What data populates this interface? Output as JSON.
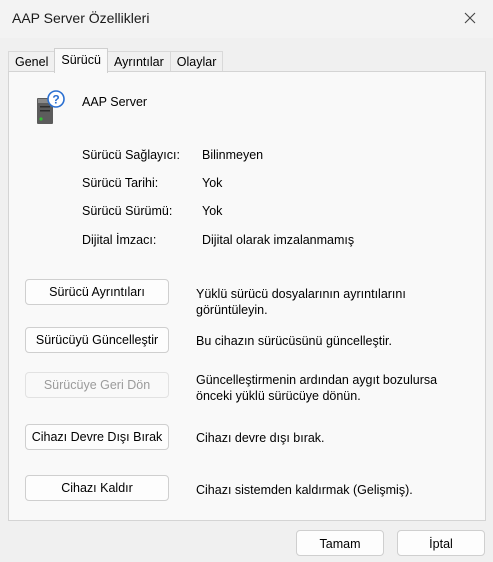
{
  "window": {
    "title": "AAP Server Özellikleri",
    "close_icon": "close-icon"
  },
  "tabs": [
    {
      "label": "Genel"
    },
    {
      "label": "Sürücü"
    },
    {
      "label": "Ayrıntılar"
    },
    {
      "label": "Olaylar"
    }
  ],
  "active_tab": "Sürücü",
  "device": {
    "name": "AAP Server",
    "icon": "unknown-device-icon"
  },
  "properties": [
    {
      "label": "Sürücü Sağlayıcı:",
      "value": "Bilinmeyen"
    },
    {
      "label": "Sürücü Tarihi:",
      "value": "Yok"
    },
    {
      "label": "Sürücü Sürümü:",
      "value": "Yok"
    },
    {
      "label": "Dijital İmzacı:",
      "value": "Dijital olarak imzalanmamış"
    }
  ],
  "actions": [
    {
      "label": "Sürücü Ayrıntıları",
      "desc": "Yüklü sürücü dosyalarının ayrıntılarını görüntüleyin.",
      "enabled": true
    },
    {
      "label": "Sürücüyü Güncelleştir",
      "desc": "Bu cihazın sürücüsünü güncelleştir.",
      "enabled": true
    },
    {
      "label": "Sürücüye Geri Dön",
      "desc": "Güncelleştirmenin ardından aygıt bozulursa önceki yüklü sürücüye dönün.",
      "enabled": false
    },
    {
      "label": "Cihazı Devre Dışı Bırak",
      "desc": "Cihazı devre dışı bırak.",
      "enabled": true
    },
    {
      "label": "Cihazı Kaldır",
      "desc": "Cihazı sistemden kaldırmak (Gelişmiş).",
      "enabled": true
    }
  ],
  "footer": {
    "ok_label": "Tamam",
    "cancel_label": "İptal"
  }
}
